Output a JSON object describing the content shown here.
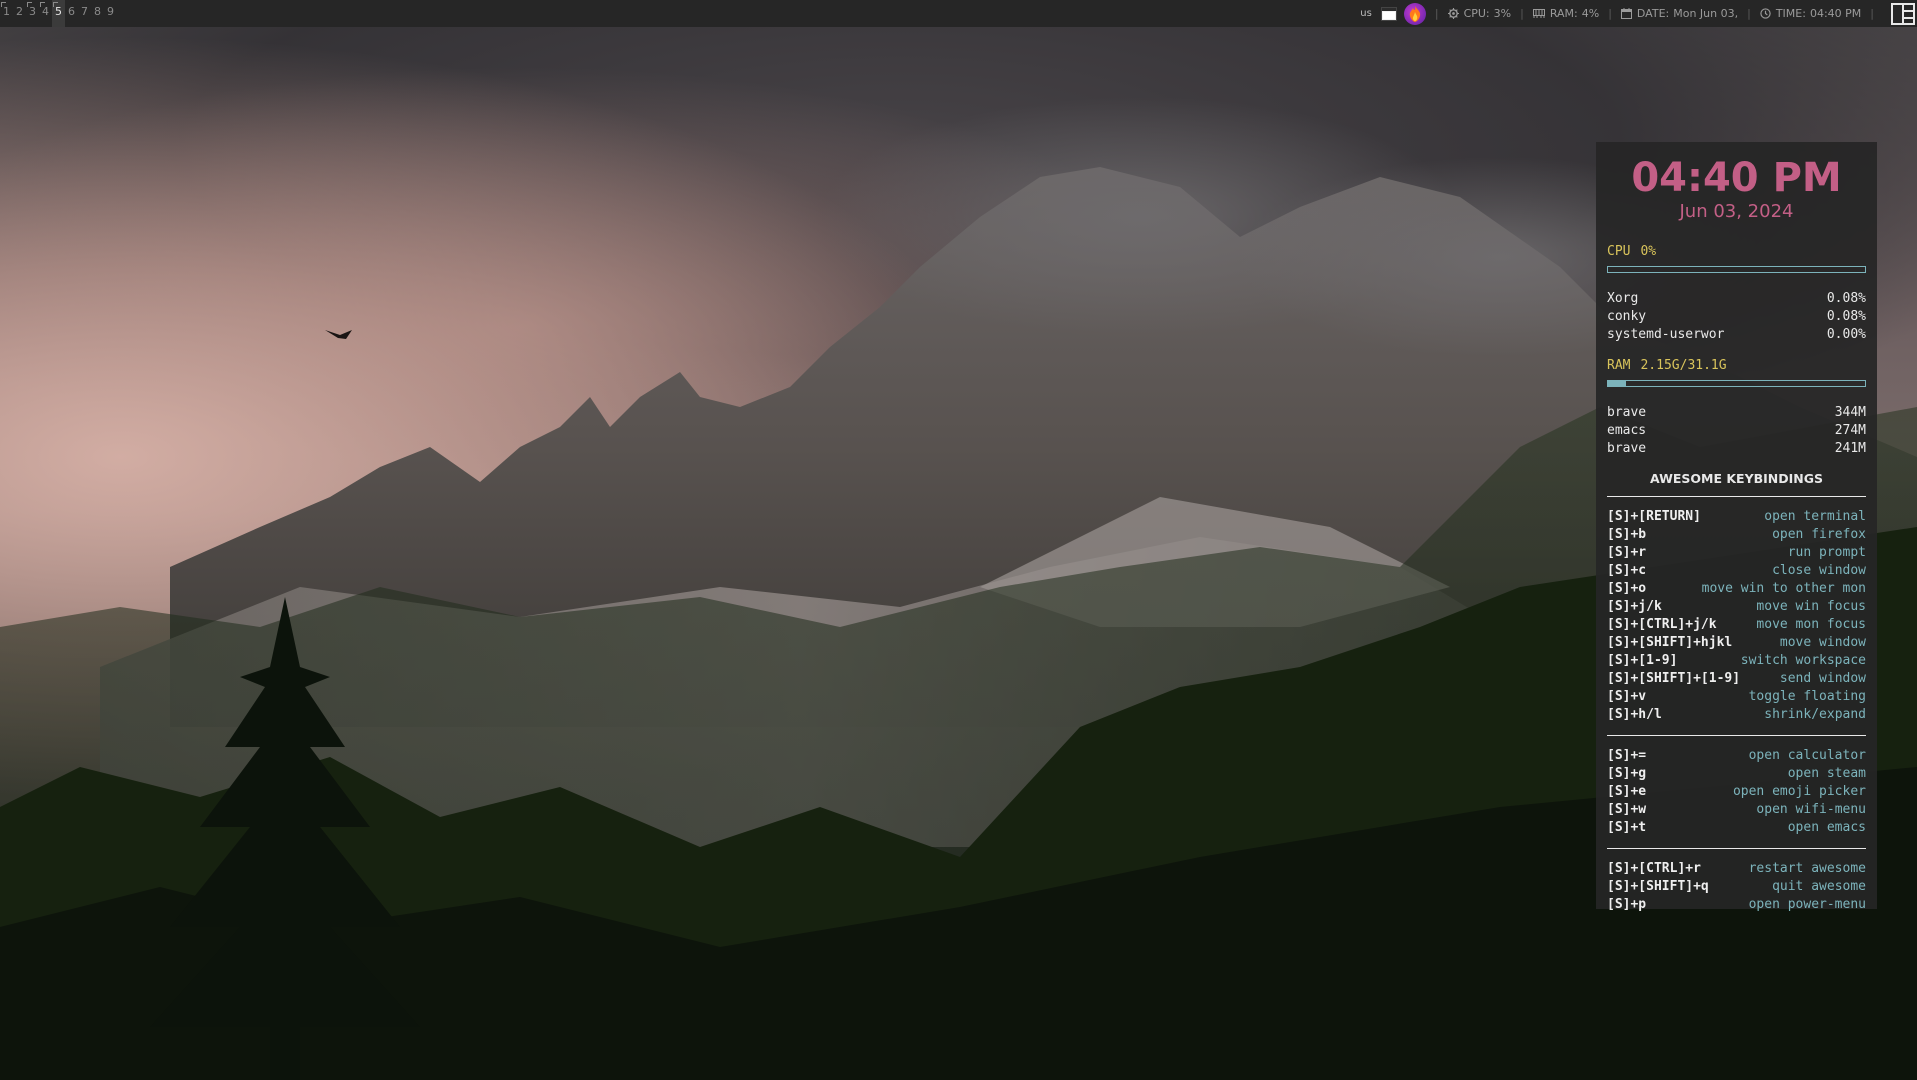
{
  "topbar": {
    "tags": [
      "1",
      "2",
      "3",
      "4",
      "5",
      "6",
      "7",
      "8",
      "9"
    ],
    "active_tag": "5",
    "occupied_tags": [
      "1",
      "3",
      "4",
      "5"
    ],
    "keyboard_layout": "us",
    "cpu": {
      "label": "CPU:",
      "value": "3%"
    },
    "ram": {
      "label": "RAM:",
      "value": "4%"
    },
    "date": {
      "label": "DATE:",
      "value": "Mon Jun 03,"
    },
    "time": {
      "label": "TIME:",
      "value": "04:40 PM"
    },
    "icons": [
      "window-icon",
      "brave-browser-icon",
      "cpu-icon",
      "ram-icon",
      "calendar-icon",
      "clock-icon",
      "layout-icon"
    ]
  },
  "conky": {
    "clock": "04:40 PM",
    "date": "Jun 03, 2024",
    "cpu": {
      "label": "CPU",
      "value": "0%",
      "fraction": 0.0,
      "processes": [
        {
          "name": "Xorg",
          "value": "0.08%"
        },
        {
          "name": "conky",
          "value": "0.08%"
        },
        {
          "name": "systemd-userwor",
          "value": "0.00%"
        }
      ]
    },
    "ram": {
      "label": "RAM",
      "value": "2.15G/31.1G",
      "fraction": 0.069,
      "processes": [
        {
          "name": "brave",
          "value": "344M"
        },
        {
          "name": "emacs",
          "value": "274M"
        },
        {
          "name": "brave",
          "value": "241M"
        }
      ]
    },
    "keybindings_title": "AWESOME KEYBINDINGS",
    "keybinding_groups": [
      [
        {
          "key": "[S]+[RETURN]",
          "action": "open terminal"
        },
        {
          "key": "[S]+b",
          "action": "open firefox"
        },
        {
          "key": "[S]+r",
          "action": "run prompt"
        },
        {
          "key": "[S]+c",
          "action": "close window"
        },
        {
          "key": "[S]+o",
          "action": "move win to other mon"
        },
        {
          "key": "[S]+j/k",
          "action": "move win focus"
        },
        {
          "key": "[S]+[CTRL]+j/k",
          "action": "move mon focus"
        },
        {
          "key": "[S]+[SHIFT]+hjkl",
          "action": "move window"
        },
        {
          "key": "[S]+[1-9]",
          "action": "switch workspace"
        },
        {
          "key": "[S]+[SHIFT]+[1-9]",
          "action": "send window"
        },
        {
          "key": "[S]+v",
          "action": "toggle floating"
        },
        {
          "key": "[S]+h/l",
          "action": "shrink/expand"
        }
      ],
      [
        {
          "key": "[S]+=",
          "action": "open calculator"
        },
        {
          "key": "[S]+g",
          "action": "open steam"
        },
        {
          "key": "[S]+e",
          "action": "open emoji picker"
        },
        {
          "key": "[S]+w",
          "action": "open wifi-menu"
        },
        {
          "key": "[S]+t",
          "action": "open emacs"
        }
      ],
      [
        {
          "key": "[S]+[CTRL]+r",
          "action": "restart awesome"
        },
        {
          "key": "[S]+[SHIFT]+q",
          "action": "quit awesome"
        },
        {
          "key": "[S]+p",
          "action": "open power-menu"
        }
      ]
    ]
  },
  "colors": {
    "accent_pink": "#c35f86",
    "accent_yellow": "#d9c45b",
    "accent_teal": "#7cb3bb"
  }
}
